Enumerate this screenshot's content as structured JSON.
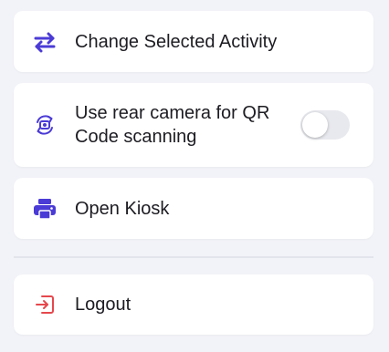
{
  "colors": {
    "accent": "#4b3bd6",
    "logout": "#e5484d",
    "text": "#1c1c22",
    "background": "#f2f3f8",
    "card": "#ffffff",
    "toggle_off": "#e8e9ee"
  },
  "menu": {
    "change_activity": {
      "label": "Change Selected Activity",
      "icon": "swap-arrows-icon"
    },
    "rear_camera": {
      "label": "Use rear camera for QR Code scanning",
      "icon": "camera-rotate-icon",
      "enabled": false
    },
    "open_kiosk": {
      "label": "Open Kiosk",
      "icon": "printer-icon"
    },
    "logout": {
      "label": "Logout",
      "icon": "logout-icon"
    }
  }
}
